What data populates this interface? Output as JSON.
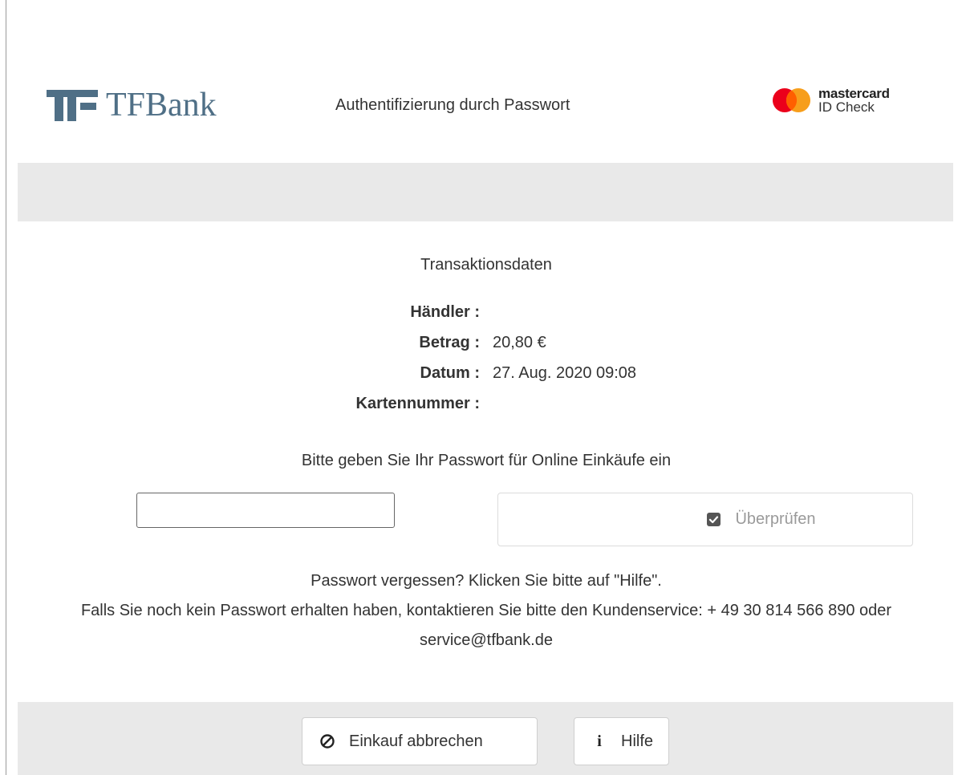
{
  "header": {
    "logo_text": "TFBank",
    "title": "Authentifizierung durch Passwort",
    "mastercard": {
      "brand": "mastercard",
      "sub": "ID Check",
      "colors": {
        "red": "#eb001b",
        "yellow": "#f79e1b",
        "overlap": "#ff5f00"
      }
    }
  },
  "transaction": {
    "title": "Transaktionsdaten",
    "rows": [
      {
        "label": "Händler :",
        "value": ""
      },
      {
        "label": "Betrag :",
        "value": "20,80 €"
      },
      {
        "label": "Datum :",
        "value": "27. Aug. 2020 09:08"
      },
      {
        "label": "Kartennummer :",
        "value": ""
      }
    ]
  },
  "form": {
    "prompt": "Bitte geben Sie Ihr Passwort für Online Einkäufe ein",
    "password_value": "",
    "verify_label": "Überprüfen",
    "verify_icon": "checkbox-checked-icon"
  },
  "info": {
    "line1": "Passwort vergessen? Klicken Sie bitte auf \"Hilfe\".",
    "line2": "Falls Sie noch kein Passwort erhalten haben, kontaktieren Sie bitte den Kundenservice: + 49 30 814 566 890 oder service@tfbank.de"
  },
  "footer": {
    "cancel_label": "Einkauf abbrechen",
    "cancel_icon": "ban-icon",
    "help_label": "Hilfe",
    "help_icon": "info-icon"
  },
  "colors": {
    "brand_blue": "#4f6f86",
    "band_gray": "#e9e9e9"
  }
}
